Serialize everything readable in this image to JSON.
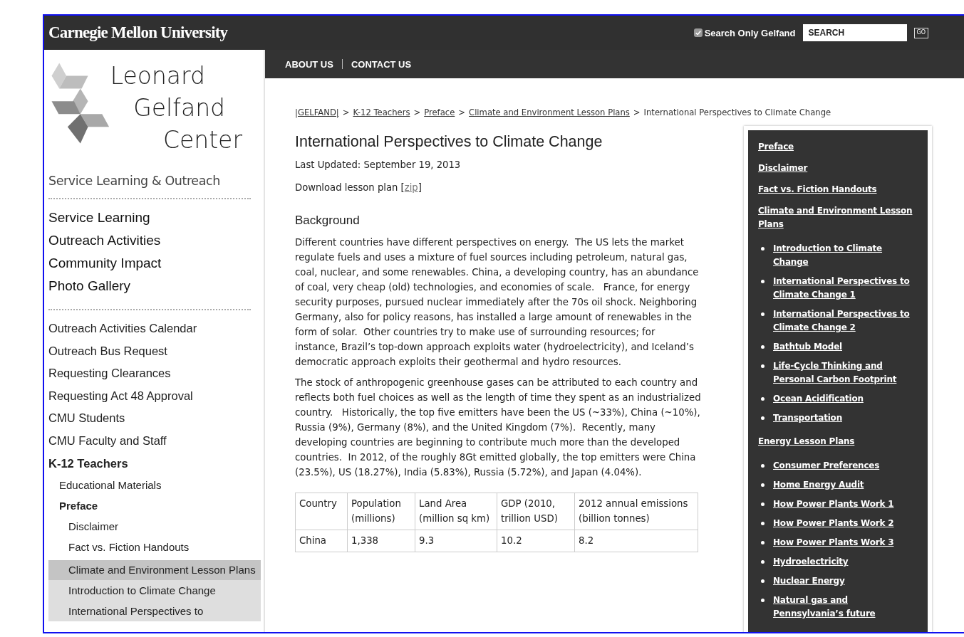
{
  "header": {
    "logo": "Carnegie Mellon University",
    "search_only": {
      "label": "Search Only Gelfand",
      "checked": true
    },
    "search": {
      "value": "SEARCH"
    },
    "go_button": "GO"
  },
  "nav": [
    "ABOUT US",
    "CONTACT US"
  ],
  "sidebar": {
    "logo": {
      "lines": [
        "Leonard",
        "Gelfand",
        "Center"
      ],
      "tagline": "Service Learning & Outreach"
    },
    "primary": [
      "Service Learning",
      "Outreach Activities",
      "Community Impact",
      "Photo Gallery"
    ],
    "secondary": [
      {
        "label": "Outreach Activities Calendar",
        "active": false,
        "selected": false
      },
      {
        "label": "Outreach Bus Request",
        "active": false,
        "selected": false
      },
      {
        "label": "Requesting Clearances",
        "active": false,
        "selected": false
      },
      {
        "label": "Requesting Act 48 Approval",
        "active": false,
        "selected": false
      },
      {
        "label": "CMU Students",
        "active": false,
        "selected": false
      },
      {
        "label": "CMU Faculty and Staff",
        "active": false,
        "selected": false
      },
      {
        "label": "K-12 Teachers",
        "active": true,
        "selected": false,
        "children": [
          {
            "label": "Educational Materials",
            "active": false,
            "selected": false
          },
          {
            "label": "Preface",
            "active": true,
            "selected": false,
            "children": [
              {
                "label": "Disclaimer",
                "active": false,
                "selected": false
              },
              {
                "label": "Fact vs. Fiction Handouts",
                "active": false,
                "selected": false
              },
              {
                "label": "Climate and Environment Lesson Plans",
                "active": false,
                "selected": true,
                "children": [
                  {
                    "label": "Introduction to Climate Change",
                    "active": false,
                    "selected": false
                  },
                  {
                    "label": "International Perspectives to",
                    "active": false,
                    "selected": false
                  }
                ]
              }
            ]
          }
        ]
      }
    ]
  },
  "breadcrumb": {
    "separator": ">",
    "links": [
      "|GELFAND|",
      "K-12 Teachers",
      "Preface",
      "Climate and Environment Lesson Plans"
    ],
    "current": "International Perspectives to Climate Change"
  },
  "article": {
    "title": "International Perspectives to Climate Change",
    "updated": "Last Updated: September 19, 2013",
    "download": {
      "prefix": "Download lesson plan [",
      "link": "zip",
      "suffix": "]"
    },
    "heading": "Background",
    "paragraphs": [
      "Different countries have different perspectives on energy.  The US lets the market regulate fuels and uses a mixture of fuel sources including petroleum, natural gas, coal, nuclear, and some renewables. China, a developing country, has an abundance of coal, very cheap (old) technologies, and economies of scale.   France, for energy security purposes, pursued nuclear immediately after the 70s oil shock. Neighboring Germany, also for policy reasons, has installed a large amount of renewables in the form of solar.  Other countries try to make use of surrounding resources; for instance, Brazil’s top-down approach exploits water (hydroelectricity), and Iceland’s democratic approach exploits their geothermal and hydro resources.",
      "The stock of anthropogenic greenhouse gases can be attributed to each country and reflects both fuel choices as well as the length of time they spent as an industrialized country.   Historically, the top five emitters have been the US (~33%), China (~10%), Russia (9%), Germany (8%), and the United Kingdom (7%).  Recently, many developing countries are beginning to contribute much more than the developed countries.  In 2012, of the roughly 8Gt emitted globally, the top emitters were China (23.5%), US (18.27%), India (5.83%), Russia (5.72%), and Japan (4.04%)."
    ],
    "table": {
      "columns": [
        "Country",
        "Population (millions)",
        "Land Area (million sq km)",
        "GDP (2010, trillion USD)",
        "2012 annual emissions (billion tonnes)"
      ],
      "rows": [
        [
          "China",
          "1,338",
          "9.3",
          "10.2",
          "8.2"
        ]
      ]
    }
  },
  "related": [
    {
      "label": "Preface"
    },
    {
      "label": "Disclaimer"
    },
    {
      "label": "Fact vs. Fiction Handouts"
    },
    {
      "label": "Climate and Environment Lesson Plans",
      "children": [
        "Introduction to Climate Change",
        "International Perspectives to Climate Change 1",
        "International Perspectives to Climate Change 2",
        "Bathtub Model",
        "Life-Cycle Thinking and Personal Carbon Footprint",
        "Ocean Acidification",
        "Transportation"
      ]
    },
    {
      "label": "Energy Lesson Plans",
      "children": [
        "Consumer Preferences",
        "Home Energy Audit",
        "How Power Plants Work 1",
        "How Power Plants Work 2",
        "How Power Plants Work 3",
        "Hydroelectricity",
        "Nuclear Energy",
        "Natural gas and Pennsylvania’s future"
      ]
    }
  ]
}
